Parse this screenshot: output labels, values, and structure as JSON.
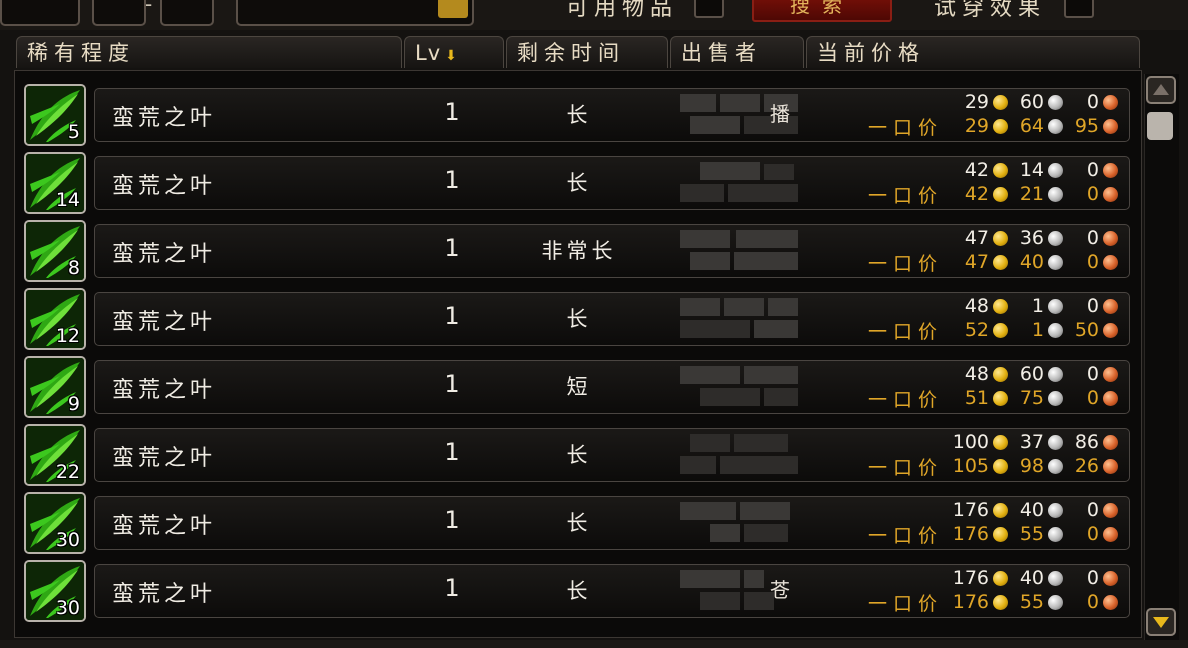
{
  "top": {
    "label_left": "可用物品",
    "search_label": "搜索",
    "label_right": "试穿效果"
  },
  "columns": {
    "rarity": "稀有程度",
    "level": "Lv",
    "time_left": "剩余时间",
    "seller": "出售者",
    "current_price": "当前价格"
  },
  "buyout_label": "一口价",
  "listings": [
    {
      "count": "5",
      "name": "蛮荒之叶",
      "level": "1",
      "time": "长",
      "seller_char": "播",
      "bid": {
        "g": "29",
        "s": "60",
        "c": "0"
      },
      "buyout": {
        "g": "29",
        "s": "64",
        "c": "95"
      }
    },
    {
      "count": "14",
      "name": "蛮荒之叶",
      "level": "1",
      "time": "长",
      "seller_char": "",
      "bid": {
        "g": "42",
        "s": "14",
        "c": "0"
      },
      "buyout": {
        "g": "42",
        "s": "21",
        "c": "0"
      }
    },
    {
      "count": "8",
      "name": "蛮荒之叶",
      "level": "1",
      "time": "非常长",
      "seller_char": "",
      "bid": {
        "g": "47",
        "s": "36",
        "c": "0"
      },
      "buyout": {
        "g": "47",
        "s": "40",
        "c": "0"
      }
    },
    {
      "count": "12",
      "name": "蛮荒之叶",
      "level": "1",
      "time": "长",
      "seller_char": "",
      "bid": {
        "g": "48",
        "s": "1",
        "c": "0"
      },
      "buyout": {
        "g": "52",
        "s": "1",
        "c": "50"
      }
    },
    {
      "count": "9",
      "name": "蛮荒之叶",
      "level": "1",
      "time": "短",
      "seller_char": "",
      "bid": {
        "g": "48",
        "s": "60",
        "c": "0"
      },
      "buyout": {
        "g": "51",
        "s": "75",
        "c": "0"
      }
    },
    {
      "count": "22",
      "name": "蛮荒之叶",
      "level": "1",
      "time": "长",
      "seller_char": "",
      "bid": {
        "g": "100",
        "s": "37",
        "c": "86"
      },
      "buyout": {
        "g": "105",
        "s": "98",
        "c": "26"
      }
    },
    {
      "count": "30",
      "name": "蛮荒之叶",
      "level": "1",
      "time": "长",
      "seller_char": "",
      "bid": {
        "g": "176",
        "s": "40",
        "c": "0"
      },
      "buyout": {
        "g": "176",
        "s": "55",
        "c": "0"
      }
    },
    {
      "count": "30",
      "name": "蛮荒之叶",
      "level": "1",
      "time": "长",
      "seller_char": "苍",
      "bid": {
        "g": "176",
        "s": "40",
        "c": "0"
      },
      "buyout": {
        "g": "176",
        "s": "55",
        "c": "0"
      }
    }
  ],
  "colors": {
    "item_green": "#3cc81e",
    "gold_text": "#e0a628",
    "search_button": "#7a1008"
  },
  "icons": {
    "item": "leaf-icon",
    "gold": "gold-coin-icon",
    "silver": "silver-coin-icon",
    "copper": "copper-coin-icon",
    "sort": "sort-arrow-icon",
    "scroll_up": "scroll-up-icon",
    "scroll_down": "scroll-down-icon"
  }
}
